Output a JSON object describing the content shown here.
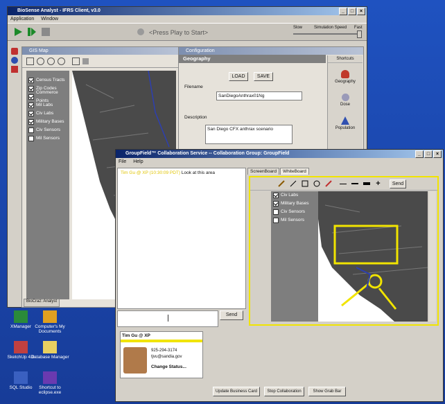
{
  "main_window": {
    "title": "BioSense Analyst - IFRS Client, v3.0",
    "menu": [
      "Application",
      "Window"
    ],
    "press_play": "<Press Play to Start>",
    "speed": {
      "slow": "Slow",
      "label": "Simulation Speed",
      "fast": "Fast"
    }
  },
  "gis_map": {
    "title": "GIS Map",
    "layers": [
      {
        "label": "Census Tracts",
        "checked": true
      },
      {
        "label": "Zip Codes",
        "checked": true
      },
      {
        "label": "Commerce Points",
        "checked": true
      },
      {
        "label": "Mil Labs",
        "checked": true
      },
      {
        "label": "Civ Labs",
        "checked": true
      },
      {
        "label": "Military Bases",
        "checked": true
      },
      {
        "label": "Civ Sensors",
        "checked": false
      },
      {
        "label": "Mil Sensors",
        "checked": false
      }
    ],
    "bottom_tab": "BioCraz: Analyst"
  },
  "configuration": {
    "title": "Configuration",
    "section": "Geography",
    "load_label": "LOAD",
    "save_label": "SAVE",
    "filename_label": "Filename",
    "filename_value": "SanDiegoAnthrax01Ng",
    "description_label": "Description",
    "description_value": "San Diego CFX anthrax scenario",
    "shortcuts_title": "Shortcuts",
    "shortcuts": [
      "Geography",
      "Dose",
      "Population"
    ]
  },
  "collab": {
    "title": "GroupField™ Collaboration Service -- Collaboration Group: GroupField",
    "menu": [
      "File",
      "Help"
    ],
    "chat_sender": "Tim Gu @ XP (10:30:09 PDT)",
    "chat_message": "Look at this area",
    "send_label": "Send",
    "tabs": [
      "ScreenBoard",
      "WhiteBoard"
    ],
    "draw_send": "Send",
    "board_layers": [
      {
        "label": "Civ Labs",
        "checked": true
      },
      {
        "label": "Military Bases",
        "checked": true
      },
      {
        "label": "Civ Sensors",
        "checked": false
      },
      {
        "label": "Mil Sensors",
        "checked": false
      }
    ],
    "card": {
      "name": "Tim Gu @ XP",
      "phone": "925-294-3174",
      "email": "tjvu@sandia.gov",
      "status": "Change Status..."
    },
    "buttons": [
      "Update Business Card",
      "Stop Collaboration",
      "Show Grab Bar"
    ]
  },
  "desktop_icons": [
    {
      "label": "XManager",
      "icon": "xmanager-icon"
    },
    {
      "label": "Computer's My Documents",
      "icon": "documents-icon"
    },
    {
      "label": "SketchUp 4.0",
      "icon": "sketchup-icon"
    },
    {
      "label": "Database Manager",
      "icon": "database-icon"
    },
    {
      "label": "SQL Studio",
      "icon": "sql-icon"
    },
    {
      "label": "Shortcut to eclipse.exe",
      "icon": "eclipse-icon"
    }
  ]
}
